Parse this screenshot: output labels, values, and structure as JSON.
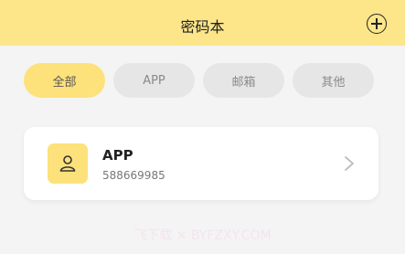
{
  "header": {
    "title": "密码本",
    "add_icon": "plus-circle-icon"
  },
  "filters": [
    {
      "label": "全部",
      "selected": true
    },
    {
      "label": "APP",
      "selected": false
    },
    {
      "label": "邮箱",
      "selected": false
    },
    {
      "label": "其他",
      "selected": false
    }
  ],
  "entries": [
    {
      "name": "APP",
      "account": "588669985",
      "icon": "user-icon"
    }
  ],
  "watermark": "飞下载 × BYFZXY.COM",
  "colors": {
    "header_bg": "#fde58a",
    "accent": "#fde17a",
    "page_bg": "#f4f4f4"
  }
}
